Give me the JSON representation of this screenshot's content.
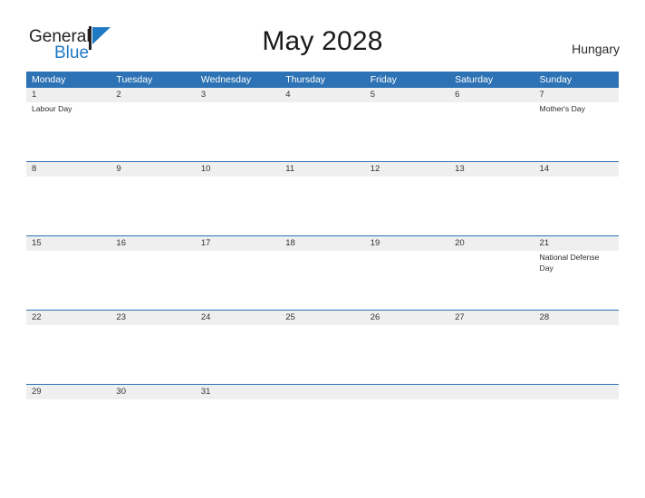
{
  "brand": {
    "name_dark": "General",
    "name_blue": "Blue",
    "flag_icon": "blue-triangle-flag",
    "accent_color": "#1f7ac4"
  },
  "header": {
    "title": "May 2028",
    "country": "Hungary"
  },
  "colors": {
    "header_blue": "#2d72b4",
    "date_band_gray": "#efefef",
    "rule_blue": "#2d72b4",
    "text_dark": "#333333"
  },
  "weekdays": [
    "Monday",
    "Tuesday",
    "Wednesday",
    "Thursday",
    "Friday",
    "Saturday",
    "Sunday"
  ],
  "weeks": [
    {
      "days": [
        {
          "date": "1",
          "events": [
            "Labour Day"
          ]
        },
        {
          "date": "2",
          "events": []
        },
        {
          "date": "3",
          "events": []
        },
        {
          "date": "4",
          "events": []
        },
        {
          "date": "5",
          "events": []
        },
        {
          "date": "6",
          "events": []
        },
        {
          "date": "7",
          "events": [
            "Mother's Day"
          ]
        }
      ]
    },
    {
      "days": [
        {
          "date": "8",
          "events": []
        },
        {
          "date": "9",
          "events": []
        },
        {
          "date": "10",
          "events": []
        },
        {
          "date": "11",
          "events": []
        },
        {
          "date": "12",
          "events": []
        },
        {
          "date": "13",
          "events": []
        },
        {
          "date": "14",
          "events": []
        }
      ]
    },
    {
      "days": [
        {
          "date": "15",
          "events": []
        },
        {
          "date": "16",
          "events": []
        },
        {
          "date": "17",
          "events": []
        },
        {
          "date": "18",
          "events": []
        },
        {
          "date": "19",
          "events": []
        },
        {
          "date": "20",
          "events": []
        },
        {
          "date": "21",
          "events": [
            "National Defense Day"
          ]
        }
      ]
    },
    {
      "days": [
        {
          "date": "22",
          "events": []
        },
        {
          "date": "23",
          "events": []
        },
        {
          "date": "24",
          "events": []
        },
        {
          "date": "25",
          "events": []
        },
        {
          "date": "26",
          "events": []
        },
        {
          "date": "27",
          "events": []
        },
        {
          "date": "28",
          "events": []
        }
      ]
    },
    {
      "days": [
        {
          "date": "29",
          "events": []
        },
        {
          "date": "30",
          "events": []
        },
        {
          "date": "31",
          "events": []
        },
        {
          "date": "",
          "events": []
        },
        {
          "date": "",
          "events": []
        },
        {
          "date": "",
          "events": []
        },
        {
          "date": "",
          "events": []
        }
      ]
    }
  ]
}
